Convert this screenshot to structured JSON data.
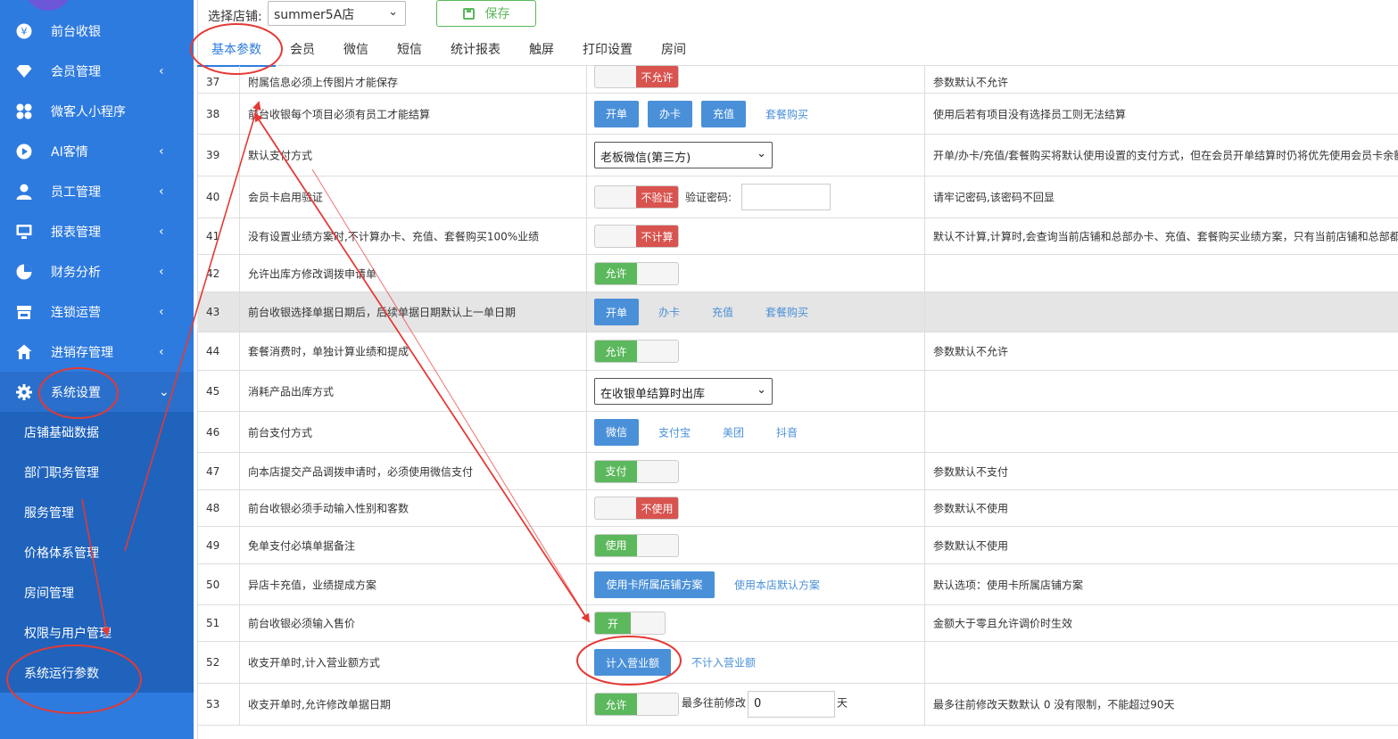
{
  "sidebar": {
    "items": [
      {
        "label": "前台收银",
        "icon": "yen-icon",
        "arrow": ""
      },
      {
        "label": "会员管理",
        "icon": "diamond-icon",
        "arrow": "‹"
      },
      {
        "label": "微客人小程序",
        "icon": "apps-icon",
        "arrow": ""
      },
      {
        "label": "AI客情",
        "icon": "play-circle-icon",
        "arrow": "‹"
      },
      {
        "label": "员工管理",
        "icon": "user-icon",
        "arrow": "‹"
      },
      {
        "label": "报表管理",
        "icon": "monitor-icon",
        "arrow": "‹"
      },
      {
        "label": "财务分析",
        "icon": "pie-chart-icon",
        "arrow": "‹"
      },
      {
        "label": "连锁运营",
        "icon": "store-icon",
        "arrow": "‹"
      },
      {
        "label": "进销存管理",
        "icon": "home-icon",
        "arrow": "‹"
      },
      {
        "label": "系统设置",
        "icon": "gear-icon",
        "arrow": "⌄"
      }
    ],
    "submenu": [
      "店铺基础数据",
      "部门职务管理",
      "服务管理",
      "价格体系管理",
      "房间管理",
      "权限与用户管理",
      "系统运行参数"
    ]
  },
  "header": {
    "store_label": "选择店铺:",
    "store_value": "summer5A店",
    "save_label": "保存"
  },
  "tabs": [
    "基本参数",
    "会员",
    "微信",
    "短信",
    "统计报表",
    "触屏",
    "打印设置",
    "房间"
  ],
  "rows": [
    {
      "num": "37",
      "name": "附属信息必须上传图片才能保存",
      "desc": "参数默认不允许",
      "toggle": {
        "state": "off",
        "label": "不允许"
      }
    },
    {
      "num": "38",
      "name": "前台收银每个项目必须有员工才能结算",
      "desc": "使用后若有项目没有选择员工则无法结算",
      "buttons": [
        "开单",
        "办卡",
        "充值"
      ],
      "links": [
        "套餐购买"
      ]
    },
    {
      "num": "39",
      "name": "默认支付方式",
      "desc": "开单/办卡/充值/套餐购买将默认使用设置的支付方式，但在会员开单结算时仍将优先使用会员卡余额",
      "select": "老板微信(第三方)"
    },
    {
      "num": "40",
      "name": "会员卡启用验证",
      "desc": "请牢记密码,该密码不回显",
      "toggle": {
        "state": "off",
        "label": "不验证"
      },
      "extra_label": "验证密码:"
    },
    {
      "num": "41",
      "name": "没有设置业绩方案时,不计算办卡、充值、套餐购买100%业绩",
      "desc": "默认不计算,计算时,会查询当前店铺和总部办卡、充值、套餐购买业绩方案，只有当前店铺和总部都",
      "toggle": {
        "state": "off",
        "label": "不计算"
      }
    },
    {
      "num": "42",
      "name": "允许出库方修改调拨申请单",
      "desc": "",
      "toggle": {
        "state": "on",
        "label": "允许"
      }
    },
    {
      "num": "43",
      "name": "前台收银选择单据日期后，后续单据日期默认上一单日期",
      "desc": "",
      "buttons": [
        "开单"
      ],
      "links": [
        "办卡",
        "充值",
        "套餐购买"
      ]
    },
    {
      "num": "44",
      "name": "套餐消费时，单独计算业绩和提成",
      "desc": "参数默认不允许",
      "toggle": {
        "state": "on",
        "label": "允许"
      }
    },
    {
      "num": "45",
      "name": "消耗产品出库方式",
      "desc": "",
      "select": "在收银单结算时出库"
    },
    {
      "num": "46",
      "name": "前台支付方式",
      "desc": "",
      "buttons": [
        "微信"
      ],
      "links": [
        "支付宝",
        "美团",
        "抖音"
      ]
    },
    {
      "num": "47",
      "name": "向本店提交产品调拨申请时，必须使用微信支付",
      "desc": "参数默认不支付",
      "toggle": {
        "state": "on",
        "label": "支付"
      }
    },
    {
      "num": "48",
      "name": "前台收银必须手动输入性别和客数",
      "desc": "参数默认不使用",
      "toggle": {
        "state": "off",
        "label": "不使用"
      }
    },
    {
      "num": "49",
      "name": "免单支付必填单据备注",
      "desc": "参数默认不使用",
      "toggle": {
        "state": "on",
        "label": "使用"
      }
    },
    {
      "num": "50",
      "name": "异店卡充值，业绩提成方案",
      "desc": "默认选项：使用卡所属店铺方案",
      "buttons": [
        "使用卡所属店铺方案"
      ],
      "links": [
        "使用本店默认方案"
      ]
    },
    {
      "num": "51",
      "name": "前台收银必须输入售价",
      "desc": "金额大于零且允许调价时生效",
      "toggle": {
        "state": "on",
        "label": "开"
      }
    },
    {
      "num": "52",
      "name": "收支开单时,计入营业额方式",
      "desc": "",
      "buttons": [
        "计入营业额"
      ],
      "links": [
        "不计入营业额"
      ]
    },
    {
      "num": "53",
      "name": "收支开单时,允许修改单据日期",
      "desc": "最多往前修改天数默认 0 没有限制，不能超过90天",
      "toggle": {
        "state": "on",
        "label": "允许"
      },
      "extra_label": "最多往前修改",
      "input_value": "0",
      "unit": "天"
    }
  ],
  "colors": {
    "sidebar": "#2e7be0",
    "submenu": "#1f63bd",
    "primary_button": "#4a90d9",
    "toggle_on": "#5cb85c",
    "toggle_off": "#d9534f",
    "annotation": "#e53935"
  }
}
